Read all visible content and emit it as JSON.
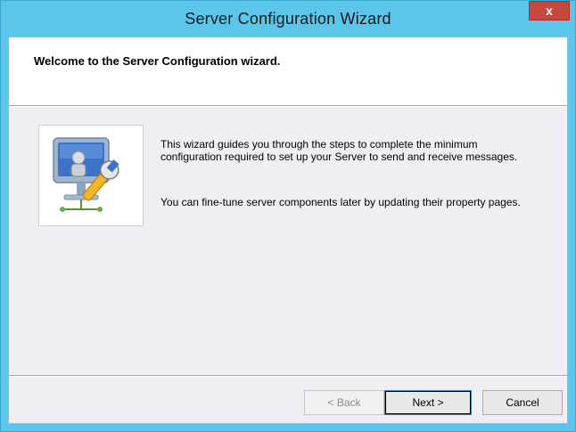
{
  "window": {
    "title": "Server Configuration Wizard",
    "close_label": "x"
  },
  "header": {
    "title": "Welcome to the Server Configuration wizard."
  },
  "body": {
    "paragraph1": "This wizard guides you through the steps to complete the minimum configuration required to set up your Server to send and receive messages.",
    "paragraph2": "You can fine-tune server components later by updating their property pages.",
    "graphic_icon": "server-configuration-icon"
  },
  "buttons": {
    "back": "< Back",
    "back_enabled": false,
    "next": "Next >",
    "cancel": "Cancel"
  },
  "colors": {
    "frame": "#5cc6ea",
    "close": "#c7483e",
    "client": "#f1eef3"
  }
}
